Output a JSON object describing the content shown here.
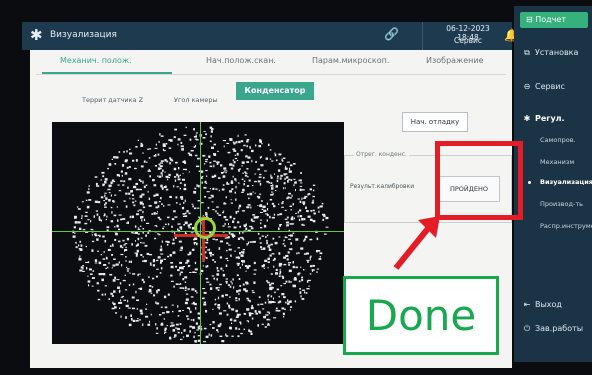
{
  "topbar": {
    "title": "Визуализация",
    "date": "06-12-2023 18:48",
    "user": "Сервис",
    "icons": [
      "star-icon",
      "link-icon",
      "bell-icon"
    ]
  },
  "sidebar": {
    "report": "Подчет",
    "items": [
      {
        "label": "Установка",
        "icon": "install-icon"
      },
      {
        "label": "Сервис",
        "icon": "service-icon"
      },
      {
        "label": "Регул.",
        "icon": "adjust-icon"
      }
    ],
    "subitems": [
      "Самопров.",
      "Механизм",
      "Визуализация",
      "Производ-ть",
      "Распр.инструмент."
    ],
    "active_subitem": "Визуализация",
    "exit": "Выход",
    "shutdown": "Зав.работы"
  },
  "tabs": [
    "Механич. полож.",
    "Нач.полож.скан.",
    "Парам.микроскоп.",
    "Изображение"
  ],
  "active_tab": "Механич. полож.",
  "subtabs": {
    "sensor_height": "Террит датчика Z",
    "camera_angle": "Угол камеры",
    "condenser": "Конденсатор"
  },
  "controls": {
    "start_debug": "Нач. отладку",
    "legend": "Отрег. конденс.",
    "calib_label": "Результ.калибровки",
    "calib_value": "ПРОЙДЕНО"
  },
  "annotation": {
    "text": "Done",
    "box_color": "#e41c25",
    "text_color": "#18a84e"
  }
}
